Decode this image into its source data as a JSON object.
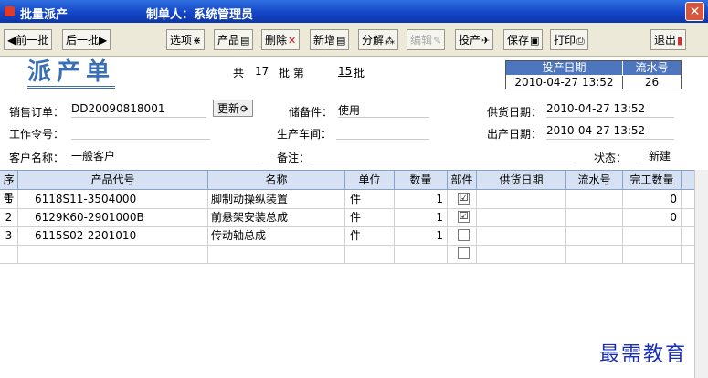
{
  "window": {
    "title": "批量派产",
    "creator": "制单人：系统管理员",
    "close_glyph": "✕"
  },
  "toolbar": {
    "prev": "◀前一批",
    "next": "后一批▶",
    "select": "选项",
    "product": "产品",
    "delete": "删除",
    "add": "新增",
    "split": "分解",
    "edit": "编辑",
    "produce": "投产",
    "save": "保存",
    "print": "打印",
    "exit": "退出"
  },
  "form": {
    "doc_title": "派产单",
    "batch_total_prefix": "共",
    "batch_total": "17",
    "batch_mid": "批  第",
    "batch_current": "15",
    "batch_suffix": "批",
    "info": {
      "h_date": "投产日期",
      "h_serial": "流水号",
      "date": "2010-04-27 13:52",
      "serial": "26"
    },
    "sales_order_label": "销售订单：",
    "sales_order": "DD20090818001",
    "refresh_label": "更新",
    "spare_label": "储备件：",
    "spare": "使用",
    "supply_date_label": "供货日期：",
    "supply_date": "2010-04-27 13:52",
    "work_order_label": "工作令号：",
    "work_order": "",
    "workshop_label": "生产车间：",
    "workshop": "",
    "out_date_label": "出产日期：",
    "out_date": "2010-04-27 13:52",
    "customer_label": "客户名称：",
    "customer": "一般客户",
    "remark_label": "备注：",
    "remark": "",
    "status_label": "状态：",
    "status": "新建"
  },
  "grid": {
    "headers": [
      "序号",
      "产品代号",
      "名称",
      "单位",
      "数量",
      "部件",
      "供货日期",
      "流水号",
      "完工数量"
    ],
    "rows": [
      {
        "no": "1",
        "code": "6118S11-3504000",
        "name": "脚制动操纵装置",
        "unit": "件",
        "qty": "1",
        "part": "☑",
        "supply_date": "",
        "serial": "",
        "done": "0"
      },
      {
        "no": "2",
        "code": "6129K60-2901000B",
        "name": "前悬架安装总成",
        "unit": "件",
        "qty": "1",
        "part": "☑",
        "supply_date": "",
        "serial": "",
        "done": "0"
      },
      {
        "no": "3",
        "code": "6115S02-2201010",
        "name": "传动轴总成",
        "unit": "件",
        "qty": "1",
        "part": "",
        "supply_date": "",
        "serial": "",
        "done": ""
      },
      {
        "no": "",
        "code": "",
        "name": "",
        "unit": "",
        "qty": "",
        "part": "",
        "supply_date": "",
        "serial": "",
        "done": ""
      }
    ]
  },
  "watermark": "最需教育",
  "colors": {
    "titlebar": "#1446c8",
    "header_bg": "#d6e2f4",
    "info_header": "#4e76bf",
    "doc_title": "#3a6fb3"
  }
}
